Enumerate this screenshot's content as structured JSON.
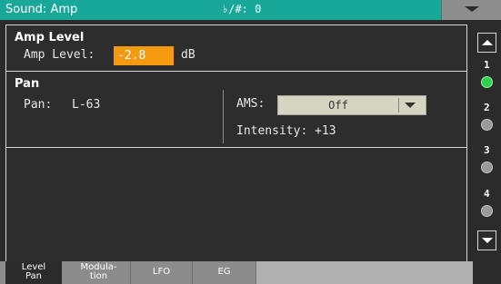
{
  "topbar": {
    "title": "Sound: Amp",
    "transpose": "♭/#: 0",
    "menu_icon": "chevron-down-icon"
  },
  "amp": {
    "title": "Amp Level",
    "level_label": "Amp Level:",
    "level_value": "-2.8",
    "level_unit": "dB"
  },
  "pan": {
    "title": "Pan",
    "pan_label": "Pan:",
    "pan_value": "L-63",
    "ams_label": "AMS:",
    "ams_value": "Off",
    "intensity_label": "Intensity:",
    "intensity_value": "+13"
  },
  "scroll": {
    "pages": [
      "1",
      "2",
      "3",
      "4"
    ],
    "active_page": "1"
  },
  "tabs": [
    {
      "label_1": "Level",
      "label_2": "Pan"
    },
    {
      "label_1": "Modula-",
      "label_2": "tion"
    },
    {
      "label_1": "LFO"
    },
    {
      "label_1": "EG"
    }
  ],
  "colors": {
    "topbar": "#18a89a",
    "value_highlight": "#f59a0e",
    "active_page_dot": "#2ed24a"
  }
}
